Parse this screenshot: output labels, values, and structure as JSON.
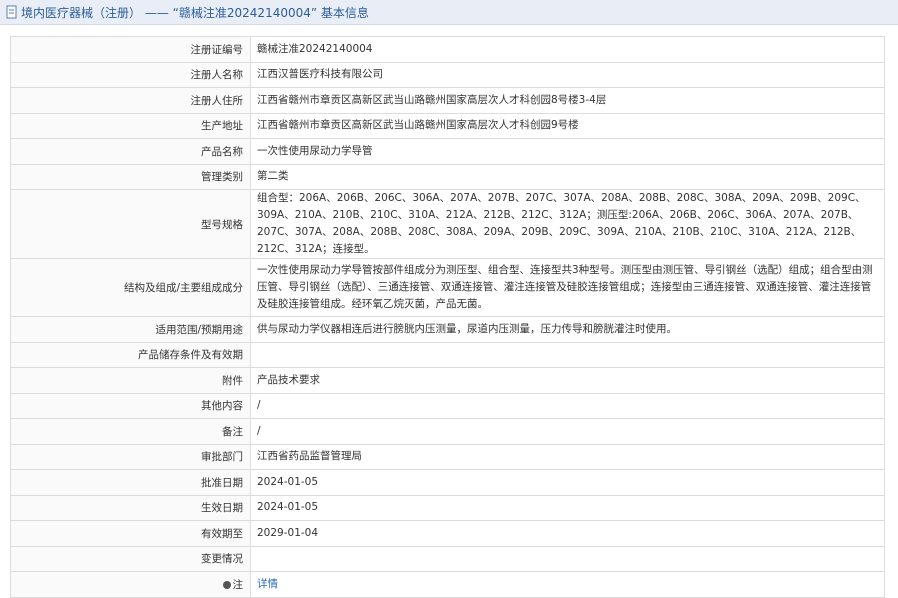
{
  "header": {
    "category": "境内医疗器械（注册）",
    "dash": "——",
    "reg_quoted": "“赣械注准20242140004”",
    "suffix": "基本信息"
  },
  "rows": [
    {
      "label": "注册证编号",
      "value": "赣械注准20242140004"
    },
    {
      "label": "注册人名称",
      "value": "江西汉普医疗科技有限公司"
    },
    {
      "label": "注册人住所",
      "value": "江西省赣州市章贡区高新区武当山路赣州国家高层次人才科创园8号楼3-4层"
    },
    {
      "label": "生产地址",
      "value": "江西省赣州市章贡区高新区武当山路赣州国家高层次人才科创园9号楼"
    },
    {
      "label": "产品名称",
      "value": "一次性使用尿动力学导管"
    },
    {
      "label": "管理类别",
      "value": "第二类"
    },
    {
      "label": "型号规格",
      "value": "组合型：206A、206B、206C、306A、207A、207B、207C、307A、208A、208B、208C、308A、209A、209B、209C、309A、210A、210B、210C、310A、212A、212B、212C、312A；测压型:206A、206B、206C、306A、207A、207B、207C、307A、208A、208B、208C、308A、209A、209B、209C、309A、210A、210B、210C、310A、212A、212B、212C、312A；连接型。"
    },
    {
      "label": "结构及组成/主要组成成分",
      "value": "一次性使用尿动力学导管按部件组成分为测压型、组合型、连接型共3种型号。测压型由测压管、导引钢丝（选配）组成；组合型由测压管、导引钢丝（选配）、三通连接管、双通连接管、灌注连接管及硅胶连接管组成；连接型由三通连接管、双通连接管、灌注连接管及硅胶连接管组成。经环氧乙烷灭菌，产品无菌。"
    },
    {
      "label": "适用范围/预期用途",
      "value": "供与尿动力学仪器相连后进行膀胱内压测量，尿道内压测量，压力传导和膀胱灌注时使用。"
    },
    {
      "label": "产品储存条件及有效期",
      "value": ""
    },
    {
      "label": "附件",
      "value": "产品技术要求"
    },
    {
      "label": "其他内容",
      "value": "/"
    },
    {
      "label": "备注",
      "value": "/"
    },
    {
      "label": "审批部门",
      "value": "江西省药品监督管理局"
    },
    {
      "label": "批准日期",
      "value": "2024-01-05"
    },
    {
      "label": "生效日期",
      "value": "2024-01-05"
    },
    {
      "label": "有效期至",
      "value": "2029-01-04"
    },
    {
      "label": "变更情况",
      "value": ""
    }
  ],
  "note": {
    "label": "注",
    "link": "详情"
  }
}
